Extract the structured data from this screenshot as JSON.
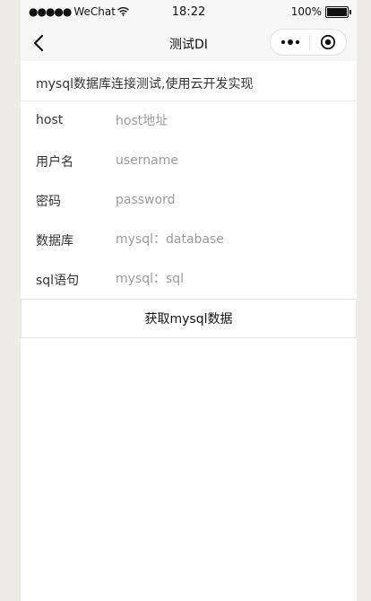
{
  "status_bar": {
    "signal": "●●●●●",
    "carrier": "WeChat",
    "time": "18:22",
    "battery": "100%"
  },
  "nav": {
    "title": "测试DI",
    "back_icon": "chevron-left-icon",
    "more_icon": "more-dots-icon",
    "close_icon": "target-circle-icon"
  },
  "header": {
    "text": "mysql数据库连接测试,使用云开发实现"
  },
  "form": {
    "fields": [
      {
        "label": "host",
        "placeholder": "host地址",
        "value": ""
      },
      {
        "label": "用户名",
        "placeholder": "username",
        "value": ""
      },
      {
        "label": "密码",
        "placeholder": "password",
        "value": ""
      },
      {
        "label": "数据库",
        "placeholder": "mysql：database",
        "value": ""
      },
      {
        "label": "sql语句",
        "placeholder": "mysql：sql",
        "value": ""
      }
    ],
    "submit_label": "获取mysql数据"
  }
}
